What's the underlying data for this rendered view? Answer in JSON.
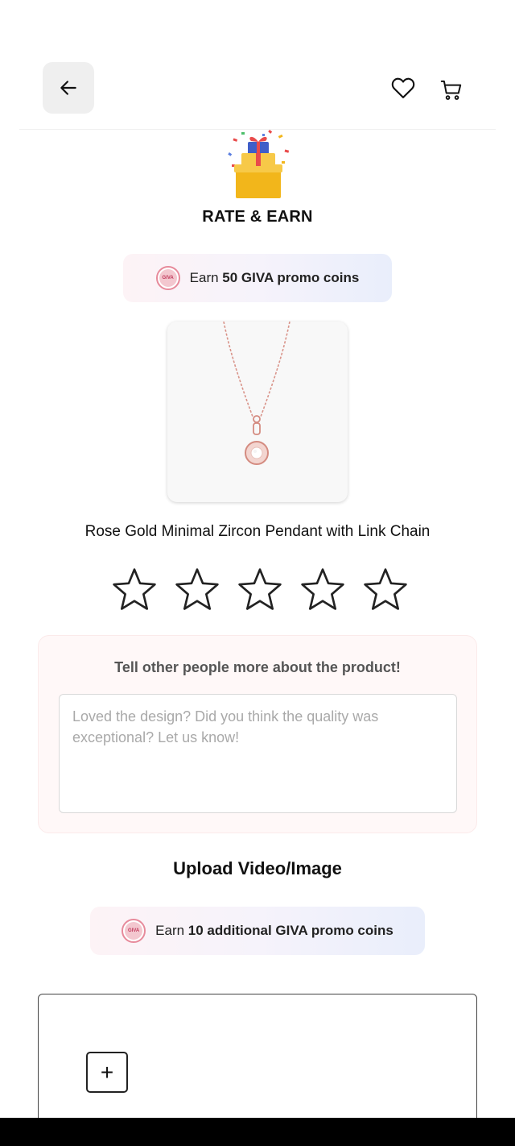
{
  "header": {
    "back_icon": "arrow-left-icon",
    "wishlist_icon": "heart-icon",
    "cart_icon": "cart-icon"
  },
  "banner": {
    "icon": "gift-box-icon",
    "title": "RATE & EARN"
  },
  "promo_top": {
    "coin_label": "GIVA",
    "prefix": "Earn ",
    "highlight": "50 GIVA promo coins"
  },
  "product": {
    "image_alt": "pendant-necklace",
    "name": "Rose Gold Minimal Zircon Pendant with Link Chain"
  },
  "rating": {
    "max_stars": 5,
    "current": 0
  },
  "review": {
    "title": "Tell other people more about the product!",
    "value": "",
    "placeholder": "Loved the design? Did you think the quality was exceptional? Let us know!"
  },
  "upload": {
    "title": "Upload Video/Image",
    "add_label": "+"
  },
  "promo_bottom": {
    "coin_label": "GIVA",
    "prefix": "Earn ",
    "highlight": "10 additional GIVA promo coins"
  },
  "colors": {
    "accent_pink": "#e78a9b",
    "review_bg": "#fff8f8"
  }
}
